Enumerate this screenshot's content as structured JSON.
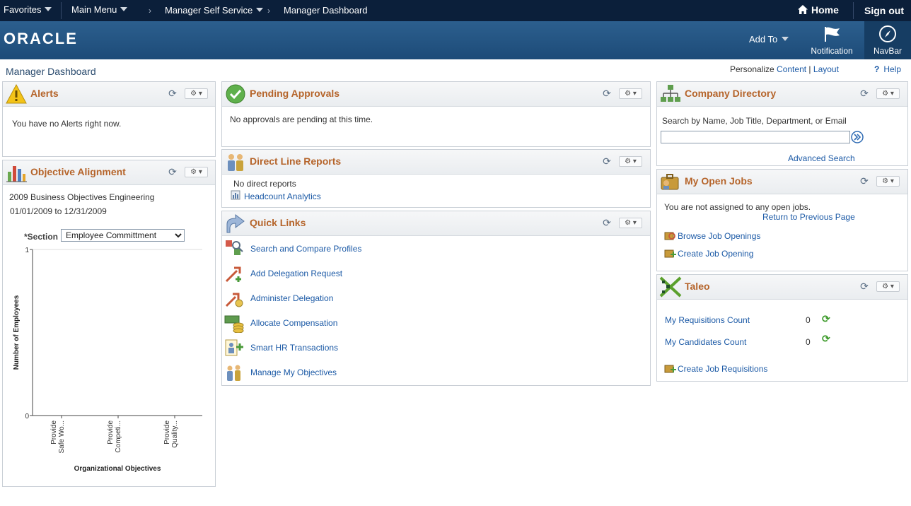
{
  "topnav": {
    "favorites": "Favorites",
    "main_menu": "Main Menu",
    "chevron": "›",
    "breadcrumb_1": "Manager Self Service",
    "breadcrumb_2": "Manager Dashboard",
    "home": "Home",
    "sign_out": "Sign out"
  },
  "banner": {
    "logo": "ORACLE",
    "add_to": "Add To",
    "notification": "Notification",
    "navbar": "NavBar"
  },
  "page": {
    "title": "Manager Dashboard",
    "personalize": "Personalize",
    "content": "Content",
    "divider": "|",
    "layout": "Layout",
    "help_mark": "?",
    "help": "Help"
  },
  "pagelets": {
    "alerts": {
      "title": "Alerts",
      "message": "You have no Alerts right now."
    },
    "objective": {
      "title": "Objective Alignment",
      "line1": "2009 Business Objectives Engineering",
      "line2": "01/01/2009 to 12/31/2009",
      "section_label": "*Section",
      "section_value": "Employee Committment"
    },
    "pending": {
      "title": "Pending Approvals",
      "message": "No approvals are pending at this time."
    },
    "direct": {
      "title": "Direct Line Reports",
      "message": "No direct reports",
      "link": "Headcount Analytics"
    },
    "quicklinks": {
      "title": "Quick Links",
      "items": [
        "Search and Compare Profiles",
        "Add Delegation Request",
        "Administer Delegation",
        "Allocate Compensation",
        "Smart HR Transactions",
        "Manage My Objectives"
      ]
    },
    "company": {
      "title": "Company Directory",
      "search_label": "Search by Name, Job Title, Department, or Email",
      "search_value": "",
      "advanced": "Advanced Search"
    },
    "openjobs": {
      "title": "My Open Jobs",
      "message": "You are not assigned to any open jobs.",
      "return": "Return to Previous Page",
      "browse": "Browse Job Openings",
      "create": "Create Job Opening"
    },
    "taleo": {
      "title": "Taleo",
      "req_label": "My Requisitions Count",
      "req_count": "0",
      "cand_label": "My Candidates Count",
      "cand_count": "0",
      "create": "Create Job Requisitions"
    }
  },
  "chart_data": {
    "type": "bar",
    "categories": [
      "Provide Safe Wo...",
      "Provide Competi...",
      "Provide Quality..."
    ],
    "category_lines": [
      [
        "Provide",
        "Safe Wo..."
      ],
      [
        "Provide",
        "Competi..."
      ],
      [
        "Provide",
        "Quality..."
      ]
    ],
    "values": [
      0,
      0,
      0
    ],
    "ylim": [
      0,
      1
    ],
    "yticks": [
      "1",
      "0"
    ],
    "xlabel": "Organizational Objectives",
    "ylabel": "Number of Employees",
    "grid": false,
    "legend": "none"
  },
  "colors": {
    "topnav": "#0b1f3a",
    "banner": "#1d4b78",
    "title_accent": "#b5642a",
    "link": "#1c5aa6"
  }
}
